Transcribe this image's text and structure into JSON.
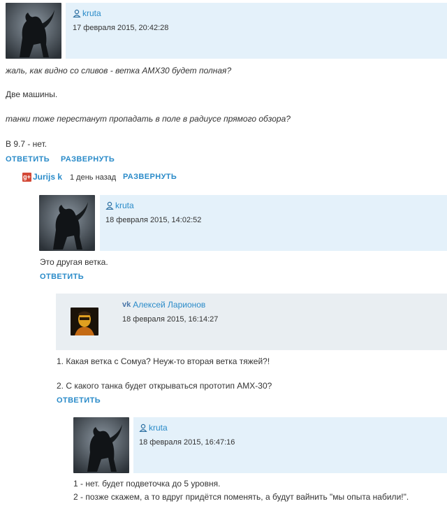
{
  "colors": {
    "header_band": "#e4f1fa",
    "header_band_alt": "#e9eef2",
    "link": "#2a8bc9",
    "text": "#333333"
  },
  "comments": [
    {
      "author": "kruta",
      "author_icon": "user-icon",
      "date": "17 февраля 2015, 20:42:28",
      "lines": [
        {
          "text": "жаль, как видно со сливов - ветка AMX30 будет полная?",
          "italic": true
        },
        {
          "text": "Две машины.",
          "italic": false
        },
        {
          "text": "танки тоже перестанут пропадать в поле в радиусе прямого обзора?",
          "italic": true
        },
        {
          "text": "В 9.7 - нет.",
          "italic": false
        }
      ],
      "reply_label": "ОТВЕТИТЬ",
      "expand_label": "РАЗВЕРНУТЬ"
    },
    {
      "collapsed": true,
      "author": "Jurijs k",
      "author_icon": "google-plus-icon",
      "time_ago": "1 день назад",
      "expand_label": "РАЗВЕРНУТЬ"
    },
    {
      "author": "kruta",
      "author_icon": "user-icon",
      "date": "18 февраля 2015, 14:02:52",
      "lines": [
        {
          "text": "Это другая ветка.",
          "italic": false
        }
      ],
      "reply_label": "ОТВЕТИТЬ"
    },
    {
      "author": "Алексей Ларионов",
      "author_icon": "vk-icon",
      "date": "18 февраля 2015, 16:14:27",
      "lines": [
        {
          "text": "1. Какая ветка с Сомуа? Неуж-то вторая ветка тяжей?!",
          "italic": false
        },
        {
          "text": "2. С какого танка будет открываться прототип AMX-30?",
          "italic": false
        }
      ],
      "reply_label": "ОТВЕТИТЬ"
    },
    {
      "author": "kruta",
      "author_icon": "user-icon",
      "date": "18 февраля 2015, 16:47:16",
      "lines": [
        {
          "text": "1 - нет. будет подветочка до 5 уровня.",
          "italic": false
        },
        {
          "text": "2 - позже скажем, а то вдруг придётся поменять, а будут вайнить \"мы опыта набили!\".",
          "italic": false
        }
      ]
    }
  ]
}
